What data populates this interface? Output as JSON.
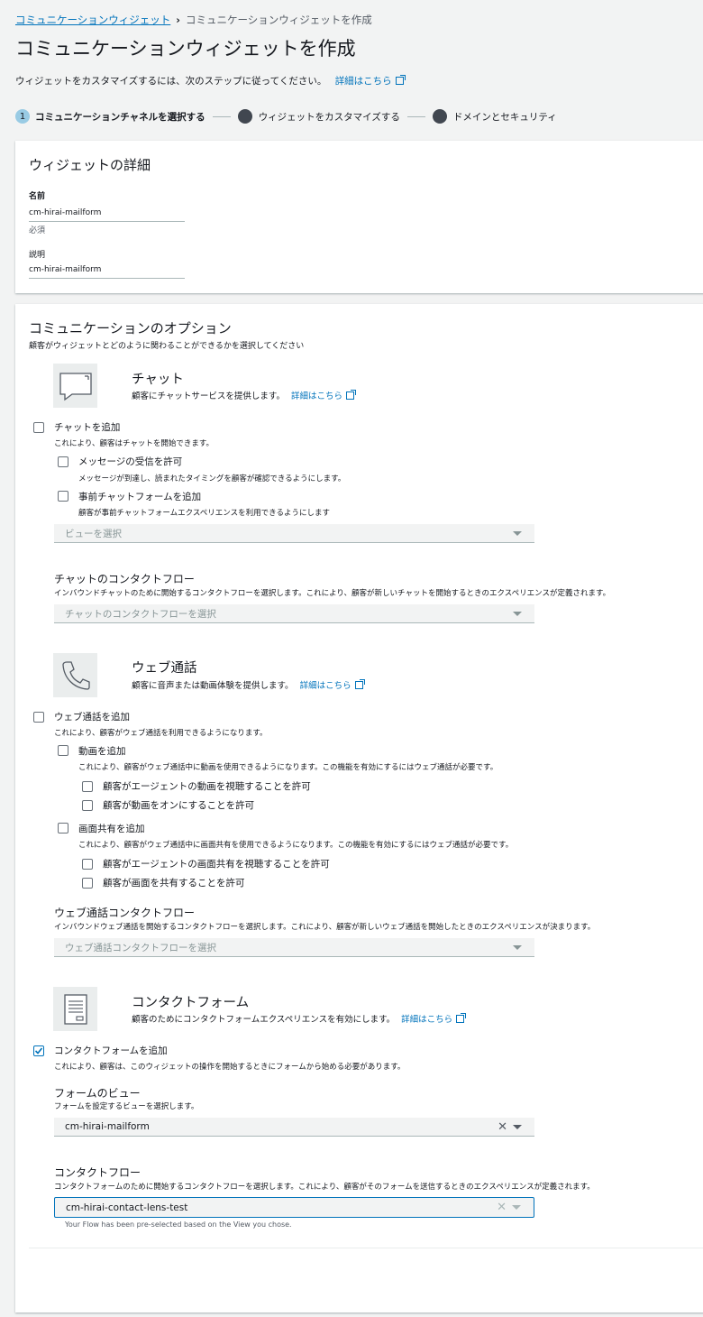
{
  "breadcrumb": {
    "parent": "コミュニケーションウィジェット",
    "current": "コミュニケーションウィジェットを作成"
  },
  "page": {
    "title": "コミュニケーションウィジェットを作成",
    "subtitle": "ウィジェットをカスタマイズするには、次のステップに従ってください。",
    "learn_more": "詳細はこちら"
  },
  "steps": [
    {
      "num": "1",
      "label": "コミュニケーションチャネルを選択する"
    },
    {
      "label": "ウィジェットをカスタマイズする"
    },
    {
      "label": "ドメインとセキュリティ"
    }
  ],
  "details": {
    "title": "ウィジェットの詳細",
    "name_label": "名前",
    "name_value": "cm-hirai-mailform",
    "name_hint": "必須",
    "desc_label": "説明",
    "desc_value": "cm-hirai-mailform"
  },
  "options": {
    "title": "コミュニケーションのオプション",
    "subtitle": "顧客がウィジェットとどのように関わることができるかを選択してください",
    "chat": {
      "title": "チャット",
      "desc": "顧客にチャットサービスを提供します。",
      "learn_more": "詳細はこちら",
      "add_label": "チャットを追加",
      "add_desc": "これにより、顧客はチャットを開始できます。",
      "receipt_label": "メッセージの受信を許可",
      "receipt_desc": "メッセージが到達し、読まれたタイミングを顧客が確認できるようにします。",
      "prechat_label": "事前チャットフォームを追加",
      "prechat_desc": "顧客が事前チャットフォームエクスペリエンスを利用できるようにします",
      "view_placeholder": "ビューを選択",
      "flow_label": "チャットのコンタクトフロー",
      "flow_desc": "インバウンドチャットのために開始するコンタクトフローを選択します。これにより、顧客が新しいチャットを開始するときのエクスペリエンスが定義されます。",
      "flow_placeholder": "チャットのコンタクトフローを選択"
    },
    "webcall": {
      "title": "ウェブ通話",
      "desc": "顧客に音声または動画体験を提供します。",
      "learn_more": "詳細はこちら",
      "add_label": "ウェブ通話を追加",
      "add_desc": "これにより、顧客がウェブ通話を利用できるようになります。",
      "video_label": "動画を追加",
      "video_desc": "これにより、顧客がウェブ通話中に動画を使用できるようになります。この機能を有効にするにはウェブ通話が必要です。",
      "video_opt1": "顧客がエージェントの動画を視聴することを許可",
      "video_opt2": "顧客が動画をオンにすることを許可",
      "screen_label": "画面共有を追加",
      "screen_desc": "これにより、顧客がウェブ通話中に画面共有を使用できるようになります。この機能を有効にするにはウェブ通話が必要です。",
      "screen_opt1": "顧客がエージェントの画面共有を視聴することを許可",
      "screen_opt2": "顧客が画面を共有することを許可",
      "flow_label": "ウェブ通話コンタクトフロー",
      "flow_desc": "インバウンドウェブ通話を開始するコンタクトフローを選択します。これにより、顧客が新しいウェブ通話を開始したときのエクスペリエンスが決まります。",
      "flow_placeholder": "ウェブ通話コンタクトフローを選択"
    },
    "contactform": {
      "title": "コンタクトフォーム",
      "desc": "顧客のためにコンタクトフォームエクスペリエンスを有効にします。",
      "learn_more": "詳細はこちら",
      "add_label": "コンタクトフォームを追加",
      "add_desc": "これにより、顧客は、このウィジェットの操作を開始するときにフォームから始める必要があります。",
      "view_label": "フォームのビュー",
      "view_desc": "フォームを設定するビューを選択します。",
      "view_value": "cm-hirai-mailform",
      "flow_label": "コンタクトフロー",
      "flow_desc": "コンタクトフォームのために開始するコンタクトフローを選択します。これにより、顧客がそのフォームを送信するときのエクスペリエンスが定義されます。",
      "flow_value": "cm-hirai-contact-lens-test",
      "flow_hint": "Your Flow has been pre-selected based on the View you chose."
    }
  }
}
